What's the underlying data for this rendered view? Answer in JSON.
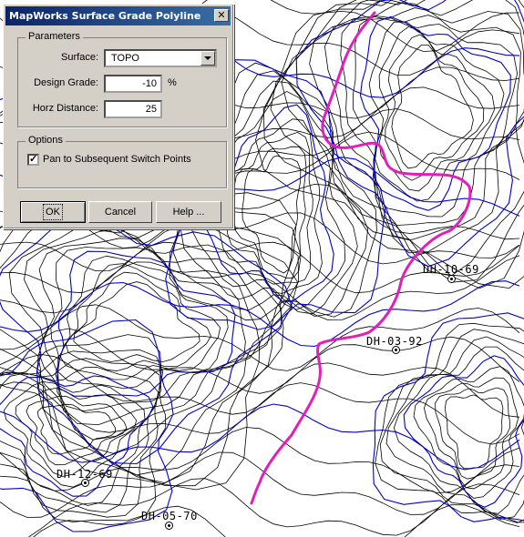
{
  "dialog": {
    "title": "MapWorks Surface Grade Polyline",
    "close_glyph": "✕",
    "parameters_legend": "Parameters",
    "surface_label": "Surface:",
    "surface_value": "TOPO",
    "design_grade_label": "Design Grade:",
    "design_grade_value": "-10",
    "design_grade_unit": "%",
    "horz_distance_label": "Horz Distance:",
    "horz_distance_value": "25",
    "options_legend": "Options",
    "pan_checkbox_label": "Pan to Subsequent Switch Points",
    "pan_checked": true,
    "check_glyph": "✓",
    "ok_label": "OK",
    "cancel_label": "Cancel",
    "help_label": "Help ..."
  },
  "map": {
    "colors": {
      "contour": "#000000",
      "index_contour": "#0000cc",
      "polyline": "#e11fb9",
      "background": "#ffffff"
    },
    "drillholes": [
      "DH-10-69",
      "DH-03-92",
      "DH-12-69",
      "DH-05-70"
    ]
  }
}
